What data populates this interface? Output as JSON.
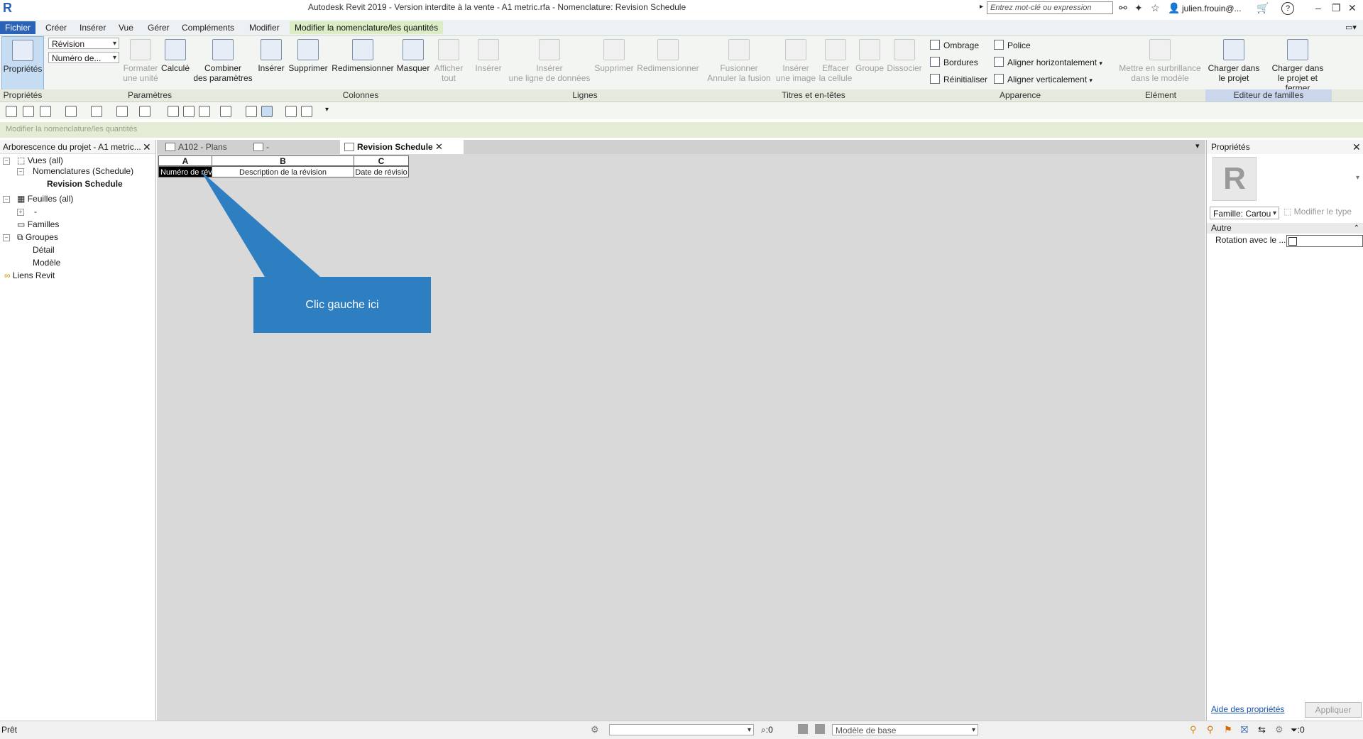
{
  "titlebar": {
    "logo": "R",
    "title": "Autodesk Revit 2019 - Version interdite à la vente - A1 metric.rfa - Nomenclature: Revision Schedule",
    "search_placeholder": "Entrez mot-clé ou expression",
    "user": "julien.frouin@...",
    "help": "?"
  },
  "menu": {
    "tabs": [
      "Fichier",
      "Créer",
      "Insérer",
      "Vue",
      "Gérer",
      "Compléments",
      "Modifier",
      "Modifier la nomenclature/les quantités"
    ]
  },
  "ribbon": {
    "proprietes": "Propriétés",
    "param_dd1": "Révision",
    "param_dd2": "Numéro de...",
    "formater": "Formater\nune unité",
    "calcule": "Calculé",
    "combiner": "Combiner\ndes paramètres",
    "inserer": "Insérer",
    "supprimer": "Supprimer",
    "redimensionner": "Redimensionner",
    "masquer": "Masquer",
    "afficher": "Afficher\ntout",
    "l_inserer": "Insérer",
    "l_inserer_ligne": "Insérer\nune ligne de données",
    "l_supprimer": "Supprimer",
    "l_redim": "Redimensionner",
    "fusionner": "Fusionner\nAnnuler la fusion",
    "inserer_image": "Insérer\nune image",
    "effacer": "Effacer\nla cellule",
    "groupe": "Groupe",
    "dissocier": "Dissocier",
    "ombrage": "Ombrage",
    "bordures": "Bordures",
    "reinitialiser": "Réinitialiser",
    "police": "Police",
    "align_h": "Aligner  horizontalement",
    "align_v": "Aligner  verticalement",
    "mettre": "Mettre en surbrillance\ndans le modèle",
    "charger": "Charger dans\nle projet",
    "charger_fermer": "Charger dans\nle projet et fermer"
  },
  "panels": [
    "Propriétés",
    "Paramètres",
    "Colonnes",
    "Lignes",
    "Titres et en-têtes",
    "Apparence",
    "Elément",
    "Editeur de familles"
  ],
  "context_text": "Modifier la nomenclature/les quantités",
  "browser": {
    "title": "Arborescence du projet - A1 metric...",
    "nodes": [
      "Vues (all)",
      "Nomenclatures (Schedule)",
      "Revision Schedule",
      "Feuilles (all)",
      "-",
      "Familles",
      "Groupes",
      "Détail",
      "Modèle",
      "Liens Revit"
    ]
  },
  "view_tabs": [
    "A102 - Plans",
    "-",
    "Revision Schedule"
  ],
  "schedule": {
    "columns": [
      "A",
      "B",
      "C"
    ],
    "headers": [
      "Numéro de révi",
      "Description de la révision",
      "Date de révisio"
    ]
  },
  "callout": "Clic gauche ici",
  "properties": {
    "title": "Propriétés",
    "family": "Famille: Cartou",
    "edit_type": "Modifier le type",
    "group": "Autre",
    "row_label": "Rotation avec le ...",
    "help_link": "Aide des propriétés",
    "apply": "Appliquer"
  },
  "status": {
    "left": "Prêt",
    "zero1": ":0",
    "model": "Modèle de base",
    "zero2": ":0"
  },
  "colors": {
    "accent": "#2a62b8",
    "callout": "#2e7fc2",
    "context_tab": "#dcecc5"
  }
}
